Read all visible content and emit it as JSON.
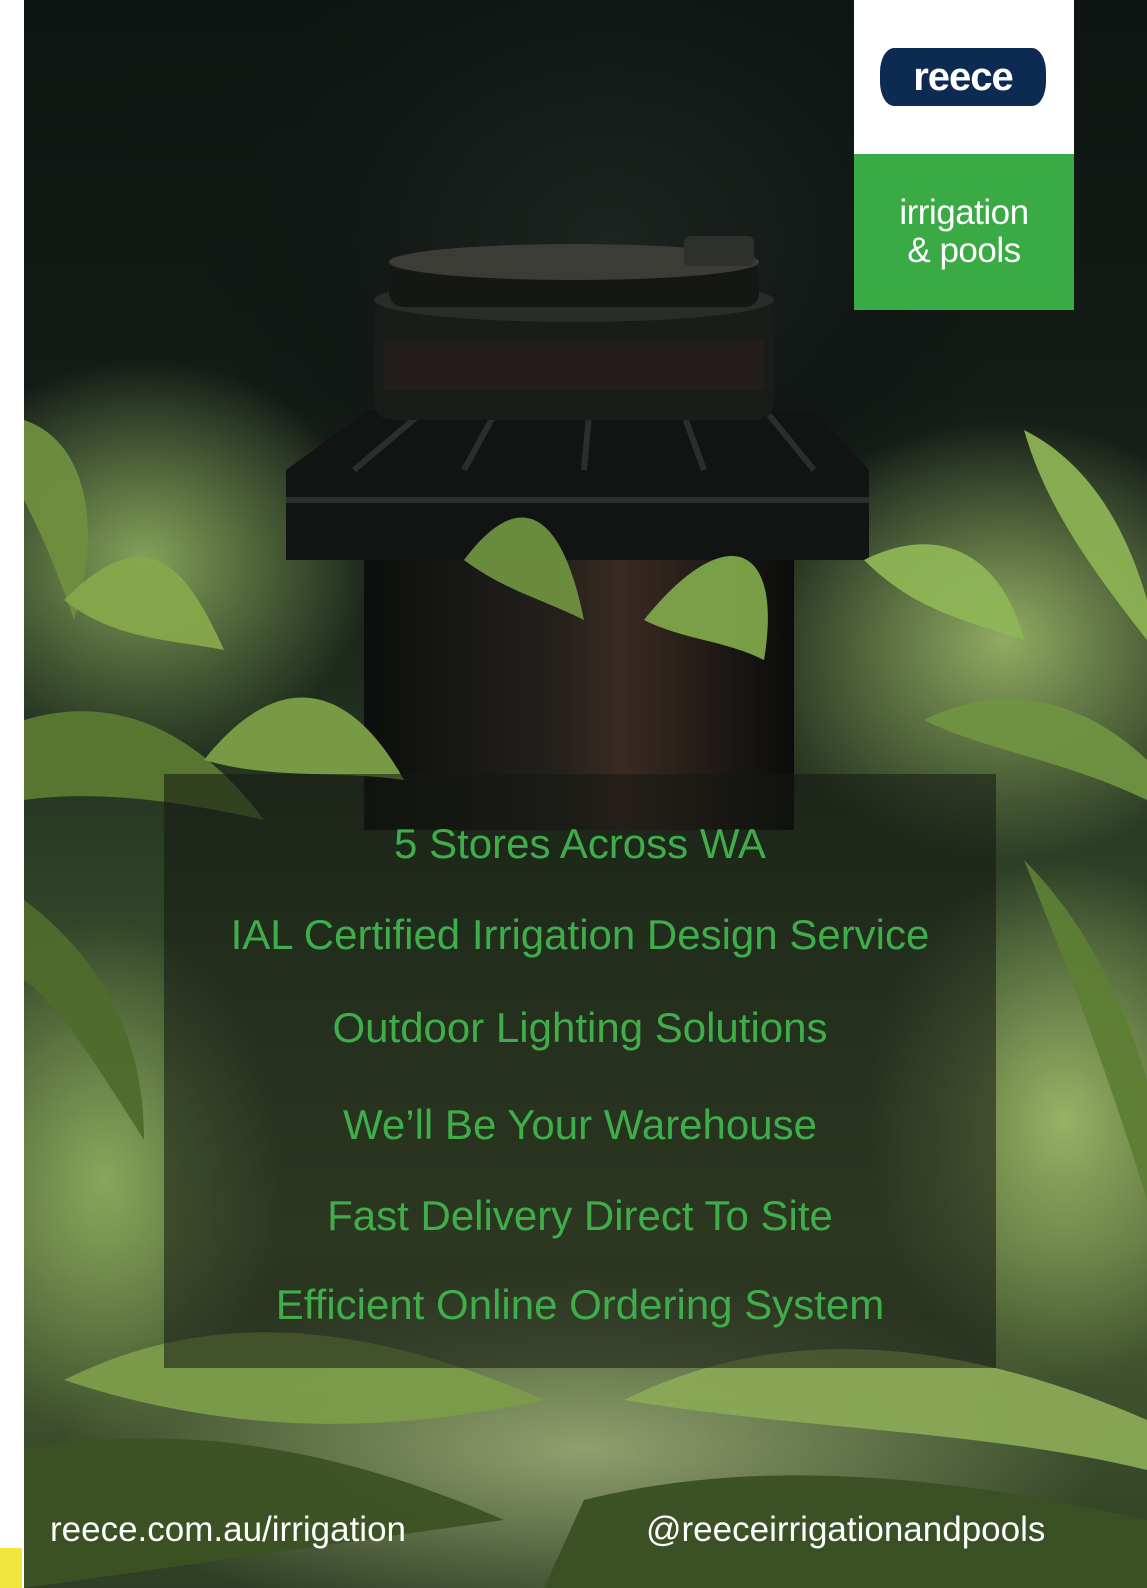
{
  "brand": {
    "logo_word": "reece",
    "division_line1": "irrigation",
    "division_line2": "& pools"
  },
  "features": [
    "5 Stores Across WA",
    "IAL Certified Irrigation Design Service",
    "Outdoor Lighting Solutions",
    "We’ll Be Your Warehouse",
    "Fast Delivery Direct To Site",
    "Efficient Online Ordering System"
  ],
  "footer": {
    "website": "reece.com.au/irrigation",
    "social_handle": "@reeceirrigationandpools"
  },
  "colors": {
    "brand_navy": "#0d2a52",
    "brand_green": "#3aaa45",
    "feature_text_green": "#3fae4a",
    "accent_yellow": "#f0e63c"
  }
}
